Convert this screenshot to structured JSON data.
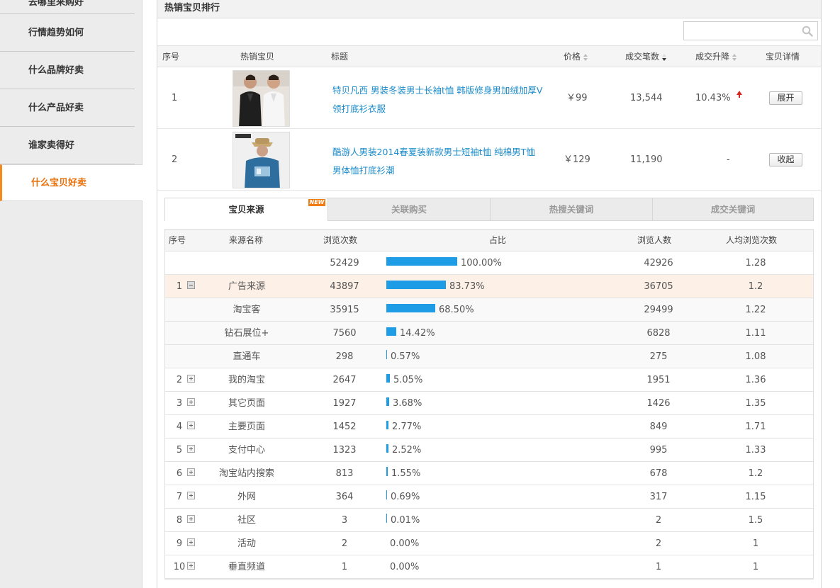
{
  "sidebar": {
    "top_partial": "去哪里采购好",
    "items": [
      {
        "label": "行情趋势如何"
      },
      {
        "label": "什么品牌好卖"
      },
      {
        "label": "什么产品好卖"
      },
      {
        "label": "谁家卖得好"
      },
      {
        "label": "什么宝贝好卖"
      }
    ],
    "active_index": 4
  },
  "panel": {
    "title": "热销宝贝排行",
    "search": {
      "value": "",
      "icon": "search-icon"
    }
  },
  "hot_table": {
    "headers": {
      "index": "序号",
      "item": "热销宝贝",
      "title": "标题",
      "price": "价格",
      "deals": "成交笔数",
      "change": "成交升降",
      "detail": "宝贝详情"
    },
    "rows": [
      {
        "index": "1",
        "title_line1": "特贝凡西 男装冬装男士长袖t恤 韩版修身男加绒加厚V",
        "title_line2": "领打底衫衣服",
        "price": "￥99",
        "deals": "13,544",
        "change": "10.43%",
        "action": "展开"
      },
      {
        "index": "2",
        "title_line1": "酷游人男装2014春夏装新款男士短袖t恤 纯棉男T恤",
        "title_line2": "男体恤打底衫潮",
        "price": "￥129",
        "deals": "11,190",
        "change": "-",
        "action": "收起"
      }
    ]
  },
  "tabs": {
    "items": [
      "宝贝来源",
      "关联购买",
      "热搜关键词",
      "成交关键词"
    ],
    "active": 0,
    "badge": "NEW"
  },
  "source_table": {
    "headers": {
      "index": "序号",
      "name": "来源名称",
      "views": "浏览次数",
      "ratio": "占比",
      "visitors": "浏览人数",
      "avg": "人均浏览次数"
    },
    "rows": [
      {
        "index": "",
        "name": "",
        "views": "52429",
        "pct": 100.0,
        "pct_text": "100.00%",
        "visitors": "42926",
        "avg": "1.28",
        "toggle": "",
        "style": "total"
      },
      {
        "index": "1",
        "name": "广告来源",
        "views": "43897",
        "pct": 83.73,
        "pct_text": "83.73%",
        "visitors": "36705",
        "avg": "1.2",
        "toggle": "minus",
        "style": "hl"
      },
      {
        "index": "",
        "name": "淘宝客",
        "views": "35915",
        "pct": 68.5,
        "pct_text": "68.50%",
        "visitors": "29499",
        "avg": "1.22",
        "toggle": "",
        "style": "sub"
      },
      {
        "index": "",
        "name": "钻石展位+",
        "views": "7560",
        "pct": 14.42,
        "pct_text": "14.42%",
        "visitors": "6828",
        "avg": "1.11",
        "toggle": "",
        "style": "sub"
      },
      {
        "index": "",
        "name": "直通车",
        "views": "298",
        "pct": 0.57,
        "pct_text": "0.57%",
        "visitors": "275",
        "avg": "1.08",
        "toggle": "",
        "style": "sub"
      },
      {
        "index": "2",
        "name": "我的淘宝",
        "views": "2647",
        "pct": 5.05,
        "pct_text": "5.05%",
        "visitors": "1951",
        "avg": "1.36",
        "toggle": "plus",
        "style": ""
      },
      {
        "index": "3",
        "name": "其它页面",
        "views": "1927",
        "pct": 3.68,
        "pct_text": "3.68%",
        "visitors": "1426",
        "avg": "1.35",
        "toggle": "plus",
        "style": ""
      },
      {
        "index": "4",
        "name": "主要页面",
        "views": "1452",
        "pct": 2.77,
        "pct_text": "2.77%",
        "visitors": "849",
        "avg": "1.71",
        "toggle": "plus",
        "style": ""
      },
      {
        "index": "5",
        "name": "支付中心",
        "views": "1323",
        "pct": 2.52,
        "pct_text": "2.52%",
        "visitors": "995",
        "avg": "1.33",
        "toggle": "plus",
        "style": ""
      },
      {
        "index": "6",
        "name": "淘宝站内搜索",
        "views": "813",
        "pct": 1.55,
        "pct_text": "1.55%",
        "visitors": "678",
        "avg": "1.2",
        "toggle": "plus",
        "style": ""
      },
      {
        "index": "7",
        "name": "外网",
        "views": "364",
        "pct": 0.69,
        "pct_text": "0.69%",
        "visitors": "317",
        "avg": "1.15",
        "toggle": "plus",
        "style": ""
      },
      {
        "index": "8",
        "name": "社区",
        "views": "3",
        "pct": 0.01,
        "pct_text": "0.01%",
        "visitors": "2",
        "avg": "1.5",
        "toggle": "plus",
        "style": ""
      },
      {
        "index": "9",
        "name": "活动",
        "views": "2",
        "pct": 0.0,
        "pct_text": "0.00%",
        "visitors": "2",
        "avg": "1",
        "toggle": "plus",
        "style": ""
      },
      {
        "index": "10",
        "name": "垂直频道",
        "views": "1",
        "pct": 0.0,
        "pct_text": "0.00%",
        "visitors": "1",
        "avg": "1",
        "toggle": "plus",
        "style": ""
      }
    ]
  },
  "colors": {
    "accent": "#e8700a",
    "link": "#1a8bc9",
    "bar": "#1e9ce5",
    "rise": "#d9261c"
  }
}
